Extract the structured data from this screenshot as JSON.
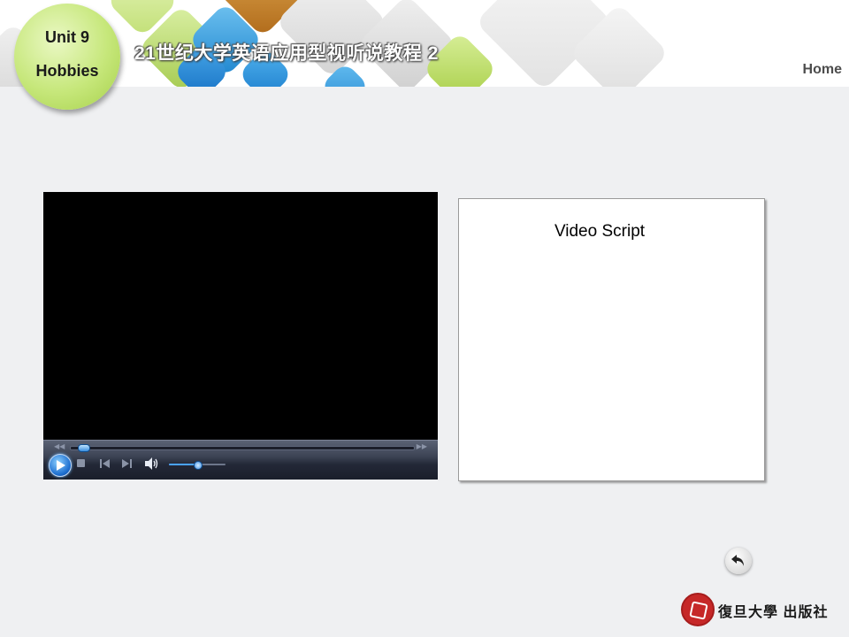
{
  "header": {
    "series_title": "21世纪大学英语应用型视听说教程 2",
    "home_label": "Home"
  },
  "unit_badge": {
    "unit": "Unit 9",
    "topic": "Hobbies"
  },
  "video_player": {
    "seek_progress": 0.02,
    "volume": 0.5
  },
  "script_panel": {
    "title": "Video Script"
  },
  "publisher": {
    "name": "復旦大學 出版社"
  },
  "colors": {
    "background": "#eff0f2",
    "badge_green": "#c6e77a",
    "seal_red": "#c62828",
    "player_accent": "#3a8fe0"
  },
  "icons": {
    "back": "back-arrow-icon",
    "play": "play-icon",
    "stop": "stop-icon",
    "previous": "previous-track-icon",
    "next": "next-track-icon",
    "volume": "speaker-icon"
  }
}
